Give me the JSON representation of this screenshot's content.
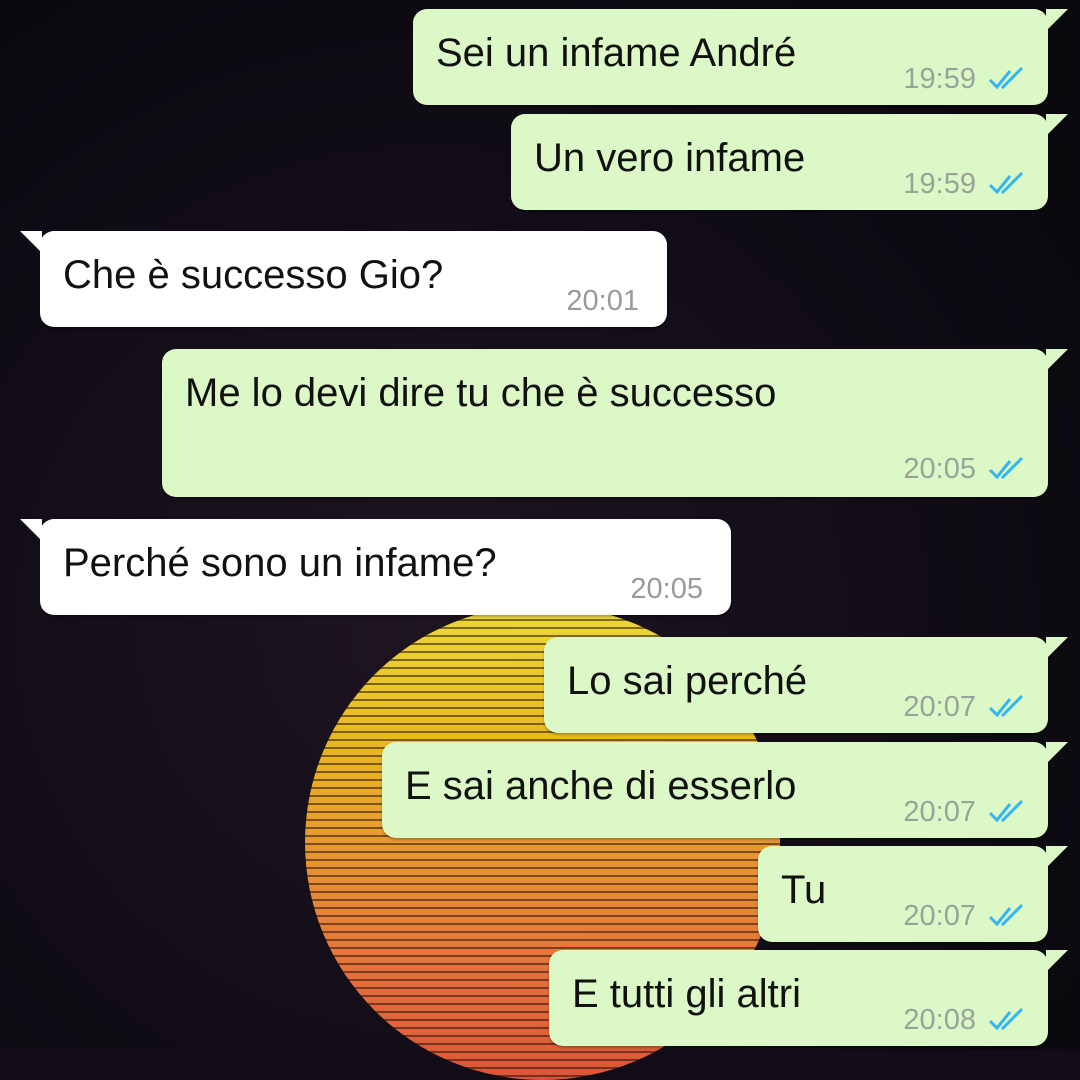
{
  "conversation": {
    "messages": [
      {
        "direction": "outgoing",
        "text": "Sei un infame André",
        "time": "19:59",
        "status": "read"
      },
      {
        "direction": "outgoing",
        "text": "Un vero infame",
        "time": "19:59",
        "status": "read"
      },
      {
        "direction": "incoming",
        "text": "Che è successo Gio?",
        "time": "20:01"
      },
      {
        "direction": "outgoing",
        "text": "Me lo devi dire tu che è successo",
        "time": "20:05",
        "status": "read"
      },
      {
        "direction": "incoming",
        "text": "Perché sono un infame?",
        "time": "20:05"
      },
      {
        "direction": "outgoing",
        "text": "Lo sai perché",
        "time": "20:07",
        "status": "read"
      },
      {
        "direction": "outgoing",
        "text": "E sai anche di esserlo",
        "time": "20:07",
        "status": "read"
      },
      {
        "direction": "outgoing",
        "text": "Tu",
        "time": "20:07",
        "status": "read"
      },
      {
        "direction": "outgoing",
        "text": "E tutti gli altri",
        "time": "20:08",
        "status": "read"
      }
    ]
  },
  "icons": {
    "read_receipt": "double-check-icon",
    "wallpaper": "sunset-wallpaper"
  },
  "colors": {
    "outgoing_bubble": "#dcf8c6",
    "incoming_bubble": "#ffffff",
    "read_tick": "#34b7f1",
    "timestamp": "#9aa39a"
  }
}
